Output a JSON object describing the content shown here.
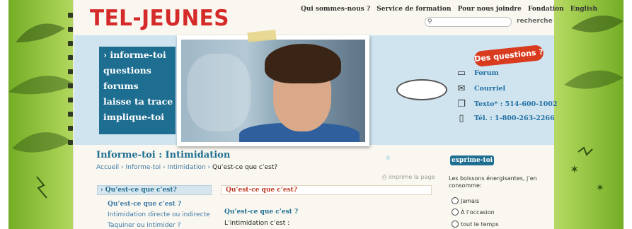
{
  "brand": {
    "logo": "TEL-JEUNES",
    "accent": "#d52a2a",
    "menu_color": "#1e6e92",
    "contact_color": "#1f6ea3"
  },
  "top_nav": [
    "Qui sommes-nous ?",
    "Service de formation",
    "Pour nous joindre",
    "Fondation",
    "English"
  ],
  "search": {
    "icon": "magnifier-icon",
    "placeholder": "",
    "label": "recherche"
  },
  "main_menu": [
    "› informe-toi",
    "questions",
    "forums",
    "laisse ta trace",
    "implique-toi"
  ],
  "questions_badge": "Des questions ?",
  "contacts": [
    {
      "icon": "speech-bubble-icon",
      "label": "Forum"
    },
    {
      "icon": "envelope-icon",
      "label": "Courriel"
    },
    {
      "icon": "chat-bubbles-icon",
      "label": "Texto* : 514-600-1002"
    },
    {
      "icon": "mobile-phone-icon",
      "label": "Tél. : 1-800-263-2266"
    }
  ],
  "page": {
    "title": "Informe-toi : Intimidation",
    "breadcrumb": [
      "Accueil",
      "Informe-toi",
      "Intimidation",
      "Qu’est-ce que c’est?"
    ],
    "breadcrumb_sep": "›",
    "print_label": "imprime la page"
  },
  "sidebar": {
    "header": "› Qu’est-ce que c’est?",
    "items": [
      "Qu’est-ce que c’est ?",
      "Intimidation directe ou indirecte",
      "Taquiner ou intimider ?"
    ]
  },
  "content": {
    "header": "Qu’est-ce que c’est?",
    "question": "Qu’est-ce que c’est ?",
    "answer": "L’intimidation c’est :"
  },
  "poll": {
    "button": "exprime-toi",
    "question": "Les boissons énergisantes, j’en consomme:",
    "options": [
      "Jamais",
      "À l’occasion",
      "tout le temps"
    ]
  }
}
